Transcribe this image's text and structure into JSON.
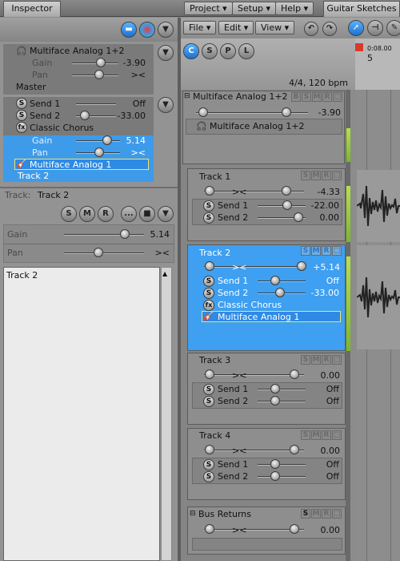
{
  "top_tabs": {
    "inspector": "Inspector",
    "song": "Guitar Sketches"
  },
  "menus": {
    "project": "Project",
    "setup": "Setup",
    "help": "Help",
    "file": "File",
    "edit": "Edit",
    "view": "View"
  },
  "tool_buttons": {
    "c": "C",
    "s": "S",
    "p": "P",
    "l": "L"
  },
  "inspector": {
    "output": {
      "name": "Multiface Analog 1+2",
      "gain_label": "Gain",
      "gain_value": "-3.90",
      "pan_label": "Pan",
      "pan_value": "><",
      "master": "Master"
    },
    "sends": [
      {
        "icon": "S",
        "name": "Send 1",
        "value": "Off"
      },
      {
        "icon": "S",
        "name": "Send 2",
        "value": "-33.00"
      }
    ],
    "fx": {
      "icon": "fx",
      "name": "Classic Chorus"
    },
    "selected": {
      "gain_label": "Gain",
      "gain_value": "5.14",
      "pan_label": "Pan",
      "pan_value": "><",
      "output": "Multiface Analog 1",
      "track": "Track 2"
    },
    "track_label": "Track:",
    "track_name": "Track 2",
    "track_buttons": {
      "s": "S",
      "m": "M",
      "r": "R",
      "more": "..."
    },
    "gain_label": "Gain",
    "gain_value": "5.14",
    "pan_label": "Pan",
    "pan_value": "><",
    "notes_text": "Track 2"
  },
  "timeline": {
    "time_signature": "4/4, 120 bpm",
    "marker_time": "0:08.00",
    "marker_bar": "5"
  },
  "mixer": {
    "master": {
      "name": "Multiface Analog 1+2",
      "gain": "-3.90",
      "input": "Multiface Analog 1+2",
      "btns": {
        "b": "B",
        "s": "S",
        "m": "M",
        "r": "R"
      }
    },
    "tracks": [
      {
        "name": "Track 1",
        "pan": "><",
        "gain": "-4.33",
        "send1_name": "Send 1",
        "send1_value": "-22.00",
        "send2_name": "Send 2",
        "send2_value": "0.00"
      },
      {
        "name": "Track 2",
        "pan": "><",
        "gain": "+5.14",
        "send1_name": "Send 1",
        "send1_value": "Off",
        "send2_name": "Send 2",
        "send2_value": "-33.00",
        "fx": "Classic Chorus",
        "output": "Multiface Analog 1"
      },
      {
        "name": "Track 3",
        "pan": "><",
        "gain": "0.00",
        "send1_name": "Send 1",
        "send1_value": "Off",
        "send2_name": "Send 2",
        "send2_value": "Off"
      },
      {
        "name": "Track 4",
        "pan": "><",
        "gain": "0.00",
        "send1_name": "Send 1",
        "send1_value": "Off",
        "send2_name": "Send 2",
        "send2_value": "Off"
      }
    ],
    "bus": {
      "name": "Bus Returns",
      "s": "S",
      "pan": "><",
      "gain": "0.00"
    },
    "smr": {
      "s": "S",
      "m": "M",
      "r": "R"
    }
  }
}
